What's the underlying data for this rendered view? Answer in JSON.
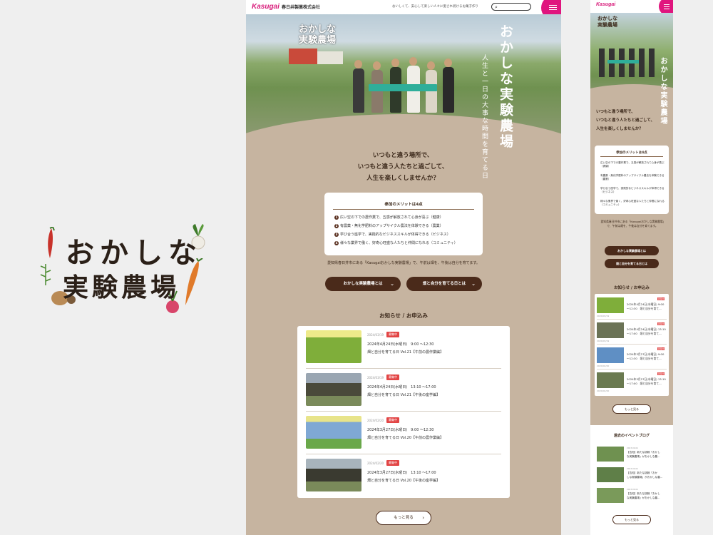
{
  "logo": {
    "line1": "おかしな",
    "line2": "実験農場"
  },
  "header": {
    "brand": "Kasugai",
    "company": "春日井製菓株式会社",
    "tagline": "おいしくて、安心して楽しい人々に愛され続けるお菓子作り",
    "menu_icon": "hamburger-icon",
    "search_icon": "search-icon"
  },
  "hero": {
    "logo": "おかしな\n実験農場",
    "title": "おかしな実験農場",
    "subtitle": "人生と一日の大事な時間を育てる日"
  },
  "intro": {
    "line1": "いつもと違う場所で、",
    "line2": "いつもと違う人たちと過ごして、",
    "line3": "人生を楽しくしませんか？"
  },
  "merit": {
    "title": "参加のメリットは4点",
    "items": [
      {
        "num": "1",
        "text": "広い空の下での農作業で、五感が解放されて心身が喜ぶ（健康）"
      },
      {
        "num": "2",
        "text": "有農薬・無化学肥料のアップサイクル農法を体験できる（農業）"
      },
      {
        "num": "3",
        "text": "学び合う座学で、実践的なビジネススキルが体得できる（ビジネス）"
      },
      {
        "num": "4",
        "text": "様々な業界で働く、好奇心旺盛な人たちと仲間になれる（コミュニティ）"
      }
    ]
  },
  "address": "愛知県春日井市にある「Kasugaiおかしな実験農場」で、午前は畑を、午後は自分を育てます。",
  "buttons": {
    "about": "おかしな実験農場とは",
    "grow": "畑と自分を育てる日とは",
    "more": "もっと見る"
  },
  "news": {
    "heading": "お知らせ / お申込み",
    "items": [
      {
        "date": "2024/03/19",
        "badge": "募集中",
        "line1": "2024年4月24日(水曜日)　9:00 〜12:30",
        "line2": "畑と自分を育てる日 Vol.21【午前の農作業編】",
        "thumb": "#7fae3a"
      },
      {
        "date": "2024/03/19",
        "badge": "募集中",
        "line1": "2024年4月24日(水曜日)　13:10 〜17:00",
        "line2": "畑と自分を育てる日 Vol.21【午後の座学編】",
        "thumb": "#6b7356"
      },
      {
        "date": "2024/02/20",
        "badge": "募集中",
        "line1": "2024年3月27日(水曜日)　9:00 〜12:30",
        "line2": "畑と自分を育てる日 Vol.20【午前の農作業編】",
        "thumb": "#5f8fc4"
      },
      {
        "date": "2024/02/20",
        "badge": "募集中",
        "line1": "2024年3月27日(水曜日)　13:10 〜17:00",
        "line2": "畑と自分を育てる日 Vol.20【午後の座学編】",
        "thumb": "#6a7a50"
      }
    ]
  },
  "mobile": {
    "intro": "いつもと違う場所で、\nいつもと違う人たちと過ごして、\n人生を楽しくしませんか？",
    "address": "愛知県春日井市にある「Kasugaiおかしな実験農場」で、午前は畑を、午後は自分を育てます。",
    "news_items": [
      {
        "date": "2024/03/19",
        "badge": "募集中",
        "line1": "2024年4月24日(水曜日) 9:00",
        "line2": "〜12:30　畑と自分を育て..."
      },
      {
        "date": "2024/03/19",
        "badge": "募集中",
        "line1": "2024年4月24日(水曜日) 13:10",
        "line2": "〜17:00　畑と自分を育て..."
      },
      {
        "date": "2024/02/20",
        "badge": "募集中",
        "line1": "2024年3月27日(水曜日) 9:00",
        "line2": "〜12:30　畑と自分を育て..."
      },
      {
        "date": "2024/02/20",
        "badge": "募集中",
        "line1": "2024年3月27日(水曜日) 13:10",
        "line2": "〜17:00　畑と自分を育て..."
      }
    ],
    "past_heading": "過去のイベントブログ",
    "past_items": [
      {
        "date": "2023.09.01",
        "line1": "【告知】新たな挑戦「おかし",
        "line2": "な実験農場」がおかしな農..."
      },
      {
        "date": "2023.09.01",
        "line1": "【告知】新たな挑戦「おか",
        "line2": "しな実験農場」がおかしな農..."
      },
      {
        "date": "2023.09.01",
        "line1": "【告知】新たな挑戦「おかし",
        "line2": "な実験農場」がおかしな農..."
      }
    ]
  }
}
